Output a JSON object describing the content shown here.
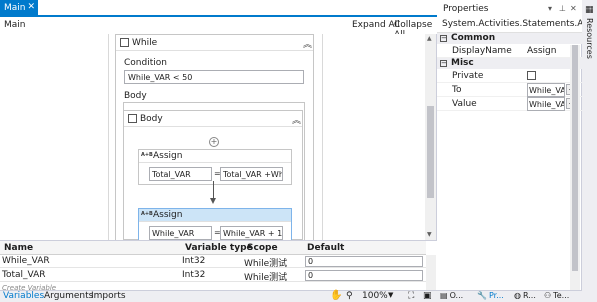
{
  "designer": {
    "tab_label": "Main",
    "tab_close": "✕",
    "breadcrumb": "Main",
    "expand_all": "Expand All",
    "collapse_all": "Collapse All"
  },
  "while_activity": {
    "title": "While",
    "condition_label": "Condition",
    "condition_value": "While_VAR < 50",
    "body_label": "Body"
  },
  "body_sequence": {
    "title": "Body",
    "assign1": {
      "title": "Assign",
      "to": "Total_VAR",
      "equals": "=",
      "value": "Total_VAR +Whil"
    },
    "assign2": {
      "title": "Assign",
      "to": "While_VAR",
      "equals": "=",
      "value": "While_VAR + 1"
    }
  },
  "variables": {
    "headers": [
      "Name",
      "Variable type",
      "Scope",
      "Default"
    ],
    "rows": [
      {
        "name": "While_VAR",
        "type": "Int32",
        "scope": "While测试",
        "default": "0"
      },
      {
        "name": "Total_VAR",
        "type": "Int32",
        "scope": "While测试",
        "default": "0"
      }
    ],
    "create_placeholder": "Create Variable"
  },
  "bottom_tabs": [
    "Variables",
    "Arguments",
    "Imports"
  ],
  "zoom": "100%",
  "properties": {
    "title": "Properties",
    "type_name": "System.Activities.Statements.Assign",
    "categories": [
      {
        "name": "Common",
        "rows": [
          {
            "name": "DisplayName",
            "value": "Assign"
          }
        ]
      },
      {
        "name": "Misc",
        "rows": [
          {
            "name": "Private",
            "value": ""
          },
          {
            "name": "To",
            "value": "While_VA"
          },
          {
            "name": "Value",
            "value": "While_VA"
          }
        ]
      }
    ],
    "bottom_tabs": [
      "O...",
      "Pr...",
      "R...",
      "Te..."
    ]
  },
  "sidebar": {
    "label": "Resources"
  },
  "icons": {
    "pin": "pin-icon",
    "collapse": "chevron-up-icon",
    "expand_node": "plus-icon",
    "minus": "minus-icon",
    "hand": "hand-icon",
    "search": "search-icon",
    "fit": "fit-screen-icon",
    "overview": "overview-icon"
  },
  "colors": {
    "accent": "#007acc",
    "assign_selected": "#cce4f7"
  }
}
